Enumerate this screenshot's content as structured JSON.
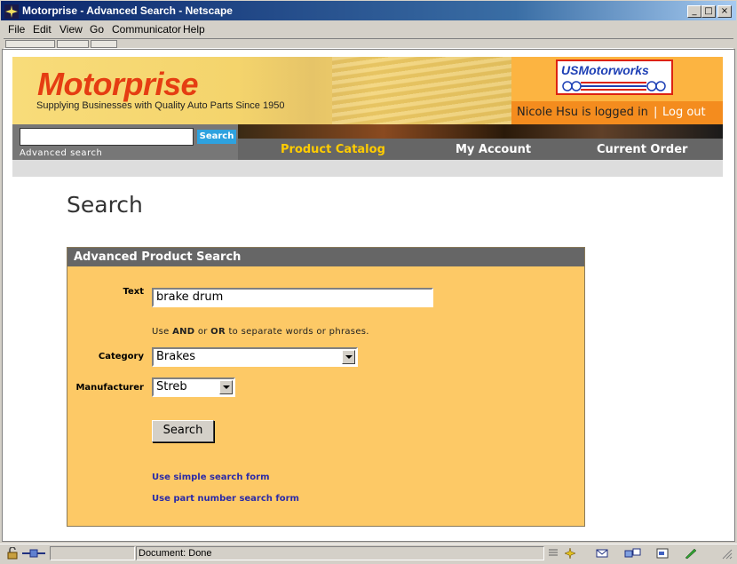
{
  "window": {
    "title": "Motorprise - Advanced Search - Netscape"
  },
  "menu": [
    "File",
    "Edit",
    "View",
    "Go",
    "Communicator",
    "Help"
  ],
  "banner": {
    "logo": "Motorprise",
    "tagline": "Supplying Businesses with Quality Auto Parts Since 1950",
    "partner_logo": "USMotorworks"
  },
  "login": {
    "user_text": "Nicole Hsu is logged in",
    "separator": "|",
    "logout": "Log out"
  },
  "quick_search": {
    "button": "Search",
    "advanced_link": "Advanced search",
    "value": ""
  },
  "nav": {
    "items": [
      "Product Catalog",
      "My Account",
      "Current Order"
    ],
    "active_color": "#ffcc00"
  },
  "page": {
    "title": "Search"
  },
  "form": {
    "heading": "Advanced Product Search",
    "text_label": "Text",
    "text_value": "brake drum",
    "hint_pre": "Use ",
    "hint_and": "AND",
    "hint_mid": " or ",
    "hint_or": "OR",
    "hint_post": " to separate words or phrases.",
    "category_label": "Category",
    "category_value": "Brakes",
    "manufacturer_label": "Manufacturer",
    "manufacturer_value": "Streb",
    "submit": "Search",
    "links": [
      "Use simple search form",
      "Use part number search form"
    ]
  },
  "status": {
    "text": "Document: Done"
  },
  "colors": {
    "logo": "#e53d12",
    "panel": "#fdc966",
    "link": "#2a2aa8",
    "login_bar": "#f48c1e"
  }
}
